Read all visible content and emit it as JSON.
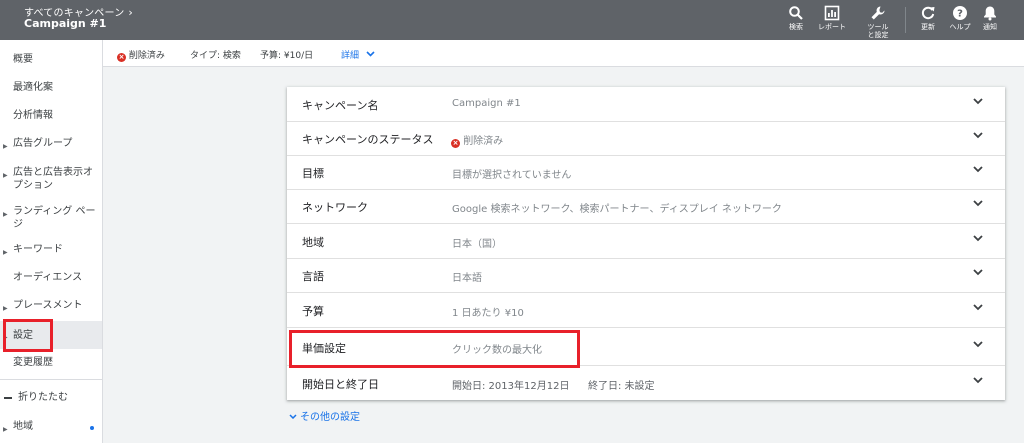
{
  "header": {
    "breadcrumb": "すべてのキャンペーン",
    "campaign_name": "Campaign #1",
    "buttons": [
      {
        "name": "search",
        "label": "検索",
        "icon": "search-icon"
      },
      {
        "name": "report",
        "label": "レポート",
        "icon": "report-icon"
      },
      {
        "name": "tools",
        "label": "ツールと設定",
        "icon": "wrench-icon"
      },
      {
        "name": "refresh",
        "label": "更新",
        "icon": "refresh-icon"
      },
      {
        "name": "help",
        "label": "ヘルプ",
        "icon": "help-icon"
      },
      {
        "name": "notifications",
        "label": "通知",
        "icon": "bell-icon"
      }
    ]
  },
  "sidebar": {
    "items": [
      {
        "label": "概要"
      },
      {
        "label": "最適化案"
      },
      {
        "label": "分析情報"
      },
      {
        "label": "広告グループ"
      },
      {
        "label": "広告と広告表示オプション"
      },
      {
        "label": "ランディング ページ"
      },
      {
        "label": "キーワード"
      },
      {
        "label": "オーディエンス"
      },
      {
        "label": "プレースメント"
      },
      {
        "label": "設定"
      },
      {
        "label": "変更履歴"
      }
    ],
    "collapse_label": "折りたたむ",
    "region_label": "地域"
  },
  "subbar": {
    "status": "削除済み",
    "type": "タイプ: 検索",
    "budget": "予算: ¥10/日",
    "details": "詳細"
  },
  "settings": {
    "rows": [
      {
        "label": "キャンペーン名",
        "value": "Campaign #1"
      },
      {
        "label": "キャンペーンのステータス",
        "value": "削除済み"
      },
      {
        "label": "目標",
        "value": "目標が選択されていません"
      },
      {
        "label": "ネットワーク",
        "value": "Google 検索ネットワーク、検索パートナー、ディスプレイ ネットワーク"
      },
      {
        "label": "地域",
        "value": "日本（国）"
      },
      {
        "label": "言語",
        "value": "日本語"
      },
      {
        "label": "予算",
        "value": "1 日あたり ¥10"
      },
      {
        "label": "単価設定",
        "value": "クリック数の最大化"
      },
      {
        "label": "開始日と終了日",
        "value": "開始日: 2013年12月12日",
        "value2": "終了日: 未設定"
      }
    ],
    "other_link": "その他の設定"
  },
  "colors": {
    "header_bg": "#5f6368",
    "accent": "#1a73e8",
    "highlight_box": "#e8202a",
    "removed_status": "#d93025"
  }
}
